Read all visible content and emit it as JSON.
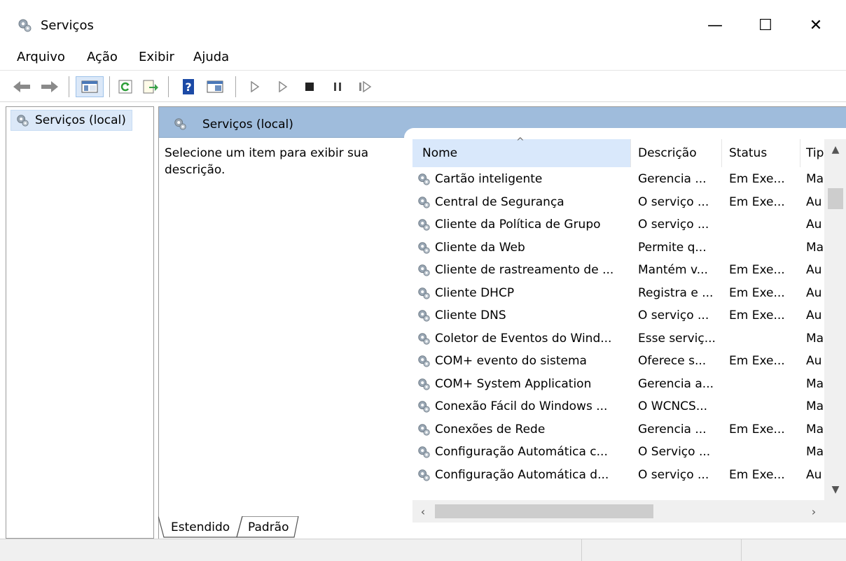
{
  "window": {
    "title": "Serviços",
    "icon": "services-gear-icon",
    "controls": {
      "minimize": "—",
      "maximize": "☐",
      "close": "✕"
    }
  },
  "menu": [
    "Arquivo",
    "Ação",
    "Exibir",
    "Ajuda"
  ],
  "toolbar": {
    "buttons": [
      "back-arrow-icon",
      "forward-arrow-icon",
      "show-hide-console-tree-icon",
      "refresh-icon",
      "export-list-icon",
      "help-icon",
      "properties-view-icon",
      "start-service-icon",
      "start-service-alt-icon",
      "stop-service-icon",
      "pause-service-icon",
      "resume-service-icon"
    ]
  },
  "tree": {
    "item": "Serviços (local)"
  },
  "content": {
    "header_title": "Serviços (local)",
    "description_prompt": "Selecione um item para exibir sua descrição."
  },
  "columns": {
    "nome": "Nome",
    "descricao": "Descrição",
    "status": "Status",
    "tipo": "Tip"
  },
  "services": [
    {
      "name": "Cartão inteligente",
      "desc": "Gerencia ...",
      "status": "Em Exe...",
      "tipo": "Ma"
    },
    {
      "name": "Central de Segurança",
      "desc": "O serviço ...",
      "status": "Em Exe...",
      "tipo": "Au"
    },
    {
      "name": "Cliente da Política de Grupo",
      "desc": "O serviço ...",
      "status": "",
      "tipo": "Au"
    },
    {
      "name": "Cliente da Web",
      "desc": "Permite q...",
      "status": "",
      "tipo": "Ma"
    },
    {
      "name": "Cliente de rastreamento de ...",
      "desc": "Mantém v...",
      "status": "Em Exe...",
      "tipo": "Au"
    },
    {
      "name": "Cliente DHCP",
      "desc": "Registra e ...",
      "status": "Em Exe...",
      "tipo": "Au"
    },
    {
      "name": "Cliente DNS",
      "desc": "O serviço ...",
      "status": "Em Exe...",
      "tipo": "Au"
    },
    {
      "name": "Coletor de Eventos do Wind...",
      "desc": "Esse serviç...",
      "status": "",
      "tipo": "Ma"
    },
    {
      "name": "COM+ evento do sistema",
      "desc": "Oferece s...",
      "status": "Em Exe...",
      "tipo": "Au"
    },
    {
      "name": "COM+ System Application",
      "desc": "Gerencia a...",
      "status": "",
      "tipo": "Ma"
    },
    {
      "name": "Conexão Fácil do Windows ...",
      "desc": "O WCNCS...",
      "status": "",
      "tipo": "Ma"
    },
    {
      "name": "Conexões de Rede",
      "desc": "Gerencia ...",
      "status": "Em Exe...",
      "tipo": "Ma"
    },
    {
      "name": "Configuração Automática c...",
      "desc": "O Serviço ...",
      "status": "",
      "tipo": "Ma"
    },
    {
      "name": "Configuração Automática d...",
      "desc": "O serviço ...",
      "status": "Em Exe...",
      "tipo": "Au"
    }
  ],
  "tabs": [
    "Estendido",
    "Padrão"
  ]
}
